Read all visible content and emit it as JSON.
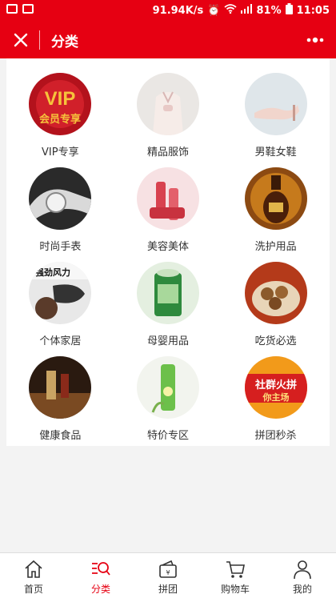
{
  "status_bar": {
    "speed": "91.94K/s",
    "battery": "81%",
    "time": "11:05"
  },
  "header": {
    "title": "分类"
  },
  "categories": [
    {
      "label": "VIP专享",
      "thumb_text": "VIP",
      "thumb_sub": "会员专享"
    },
    {
      "label": "精品服饰"
    },
    {
      "label": "男鞋女鞋"
    },
    {
      "label": "时尚手表"
    },
    {
      "label": "美容美体"
    },
    {
      "label": "洗护用品"
    },
    {
      "label": "个体家居",
      "thumb_text": "强劲风力"
    },
    {
      "label": "母婴用品"
    },
    {
      "label": "吃货必选"
    },
    {
      "label": "健康食品"
    },
    {
      "label": "特价专区"
    },
    {
      "label": "拼团秒杀",
      "thumb_text": "社群火拼",
      "thumb_sub": "你主场"
    }
  ],
  "tabs": [
    {
      "label": "首页"
    },
    {
      "label": "分类"
    },
    {
      "label": "拼团"
    },
    {
      "label": "购物车"
    },
    {
      "label": "我的"
    }
  ],
  "colors": {
    "brand": "#e60012",
    "text": "#333333",
    "background": "#f3f3f3"
  }
}
